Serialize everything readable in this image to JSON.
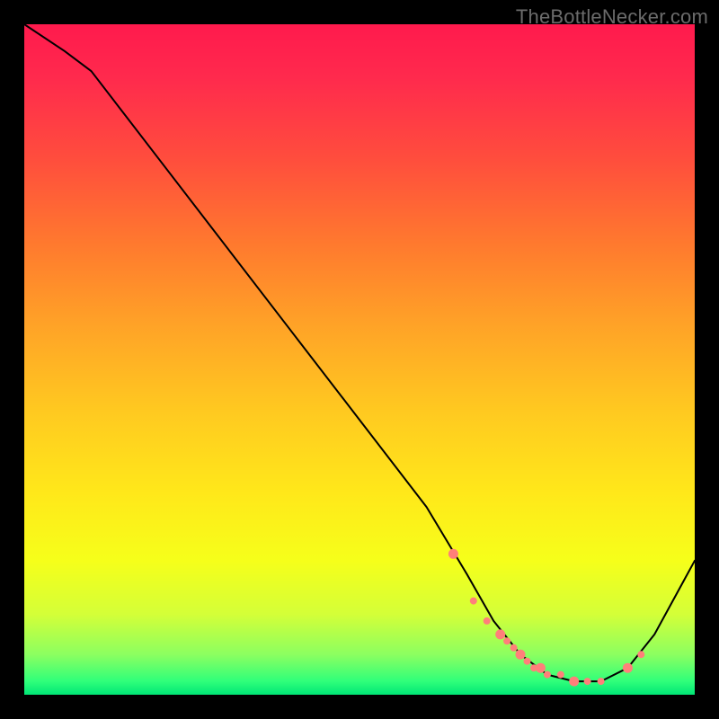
{
  "watermark": "TheBottleNecker.com",
  "chart_data": {
    "type": "line",
    "title": "",
    "xlabel": "",
    "ylabel": "",
    "xlim": [
      0,
      100
    ],
    "ylim": [
      0,
      100
    ],
    "series": [
      {
        "name": "bottleneck-curve",
        "x": [
          0,
          6,
          10,
          20,
          30,
          40,
          50,
          60,
          66,
          70,
          74,
          78,
          82,
          86,
          90,
          94,
          100
        ],
        "y": [
          100,
          96,
          93,
          80,
          67,
          54,
          41,
          28,
          18,
          11,
          6,
          3,
          2,
          2,
          4,
          9,
          20
        ]
      }
    ],
    "markers": {
      "name": "highlight-dots",
      "x": [
        64,
        67,
        69,
        71,
        72,
        73,
        74,
        75,
        76,
        77,
        78,
        80,
        82,
        84,
        86,
        90,
        92
      ],
      "y": [
        21,
        14,
        11,
        9,
        8,
        7,
        6,
        5,
        4,
        4,
        3,
        3,
        2,
        2,
        2,
        4,
        6
      ]
    },
    "gradient_note": "background encodes value: red=high bottleneck, green=low bottleneck"
  }
}
